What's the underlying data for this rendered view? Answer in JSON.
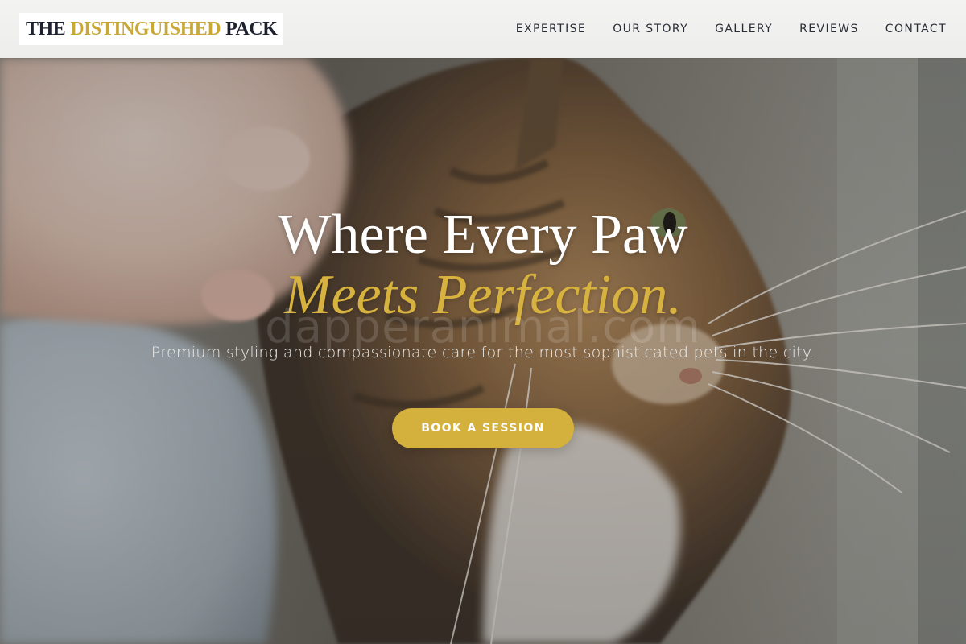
{
  "header": {
    "logo": {
      "part1": "THE",
      "part2": "DISTINGUISHED",
      "part3": "PACK"
    },
    "nav": [
      {
        "label": "EXPERTISE"
      },
      {
        "label": "OUR STORY"
      },
      {
        "label": "GALLERY"
      },
      {
        "label": "REVIEWS"
      },
      {
        "label": "CONTACT"
      }
    ]
  },
  "hero": {
    "headline_line1": "Where Every Paw",
    "headline_line2": "Meets Perfection.",
    "watermark": "dapperanimal.com",
    "subtitle": "Premium styling and compassionate care for the most sophisticated pets in the city.",
    "cta_label": "BOOK A SESSION",
    "background": "cat-photo"
  },
  "colors": {
    "gold": "#d4b03c",
    "navy": "#1e2230",
    "header_bg": "#f1f1f0"
  }
}
